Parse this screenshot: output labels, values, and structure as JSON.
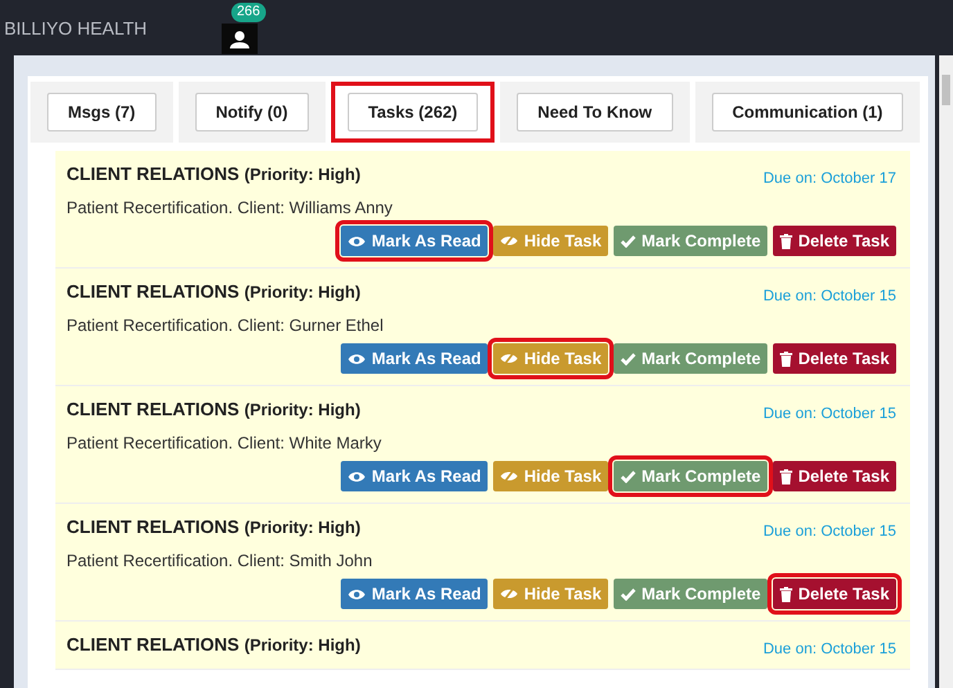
{
  "header": {
    "brand": "BILLIYO HEALTH",
    "notification_count": "266"
  },
  "tabs": [
    {
      "label": "Msgs (7)",
      "selected": false,
      "highlighted": false
    },
    {
      "label": "Notify (0)",
      "selected": false,
      "highlighted": false
    },
    {
      "label": "Tasks (262)",
      "selected": true,
      "highlighted": true
    },
    {
      "label": "Need To Know",
      "selected": false,
      "highlighted": false
    },
    {
      "label": "Communication (1)",
      "selected": false,
      "highlighted": false
    }
  ],
  "tasks": [
    {
      "category": "CLIENT RELATIONS",
      "priority": "(Priority: High)",
      "due": "Due on: October 17",
      "description": "Patient Recertification. Client: Williams Anny",
      "actions": [
        {
          "kind": "read",
          "label": "Mark As Read",
          "highlighted": true
        },
        {
          "kind": "hide",
          "label": "Hide Task",
          "highlighted": false
        },
        {
          "kind": "complete",
          "label": "Mark Complete",
          "highlighted": false
        },
        {
          "kind": "delete",
          "label": "Delete Task",
          "highlighted": false
        }
      ]
    },
    {
      "category": "CLIENT RELATIONS",
      "priority": "(Priority: High)",
      "due": "Due on: October 15",
      "description": "Patient Recertification. Client: Gurner Ethel",
      "actions": [
        {
          "kind": "read",
          "label": "Mark As Read",
          "highlighted": false
        },
        {
          "kind": "hide",
          "label": "Hide Task",
          "highlighted": true
        },
        {
          "kind": "complete",
          "label": "Mark Complete",
          "highlighted": false
        },
        {
          "kind": "delete",
          "label": "Delete Task",
          "highlighted": false
        }
      ]
    },
    {
      "category": "CLIENT RELATIONS",
      "priority": "(Priority: High)",
      "due": "Due on: October 15",
      "description": "Patient Recertification. Client: White Marky",
      "actions": [
        {
          "kind": "read",
          "label": "Mark As Read",
          "highlighted": false
        },
        {
          "kind": "hide",
          "label": "Hide Task",
          "highlighted": false
        },
        {
          "kind": "complete",
          "label": "Mark Complete",
          "highlighted": true
        },
        {
          "kind": "delete",
          "label": "Delete Task",
          "highlighted": false
        }
      ]
    },
    {
      "category": "CLIENT RELATIONS",
      "priority": "(Priority: High)",
      "due": "Due on: October 15",
      "description": "Patient Recertification. Client: Smith John",
      "actions": [
        {
          "kind": "read",
          "label": "Mark As Read",
          "highlighted": false
        },
        {
          "kind": "hide",
          "label": "Hide Task",
          "highlighted": false
        },
        {
          "kind": "complete",
          "label": "Mark Complete",
          "highlighted": false
        },
        {
          "kind": "delete",
          "label": "Delete Task",
          "highlighted": true
        }
      ]
    },
    {
      "category": "CLIENT RELATIONS",
      "priority": "(Priority: High)",
      "due": "Due on: October 15"
    }
  ]
}
